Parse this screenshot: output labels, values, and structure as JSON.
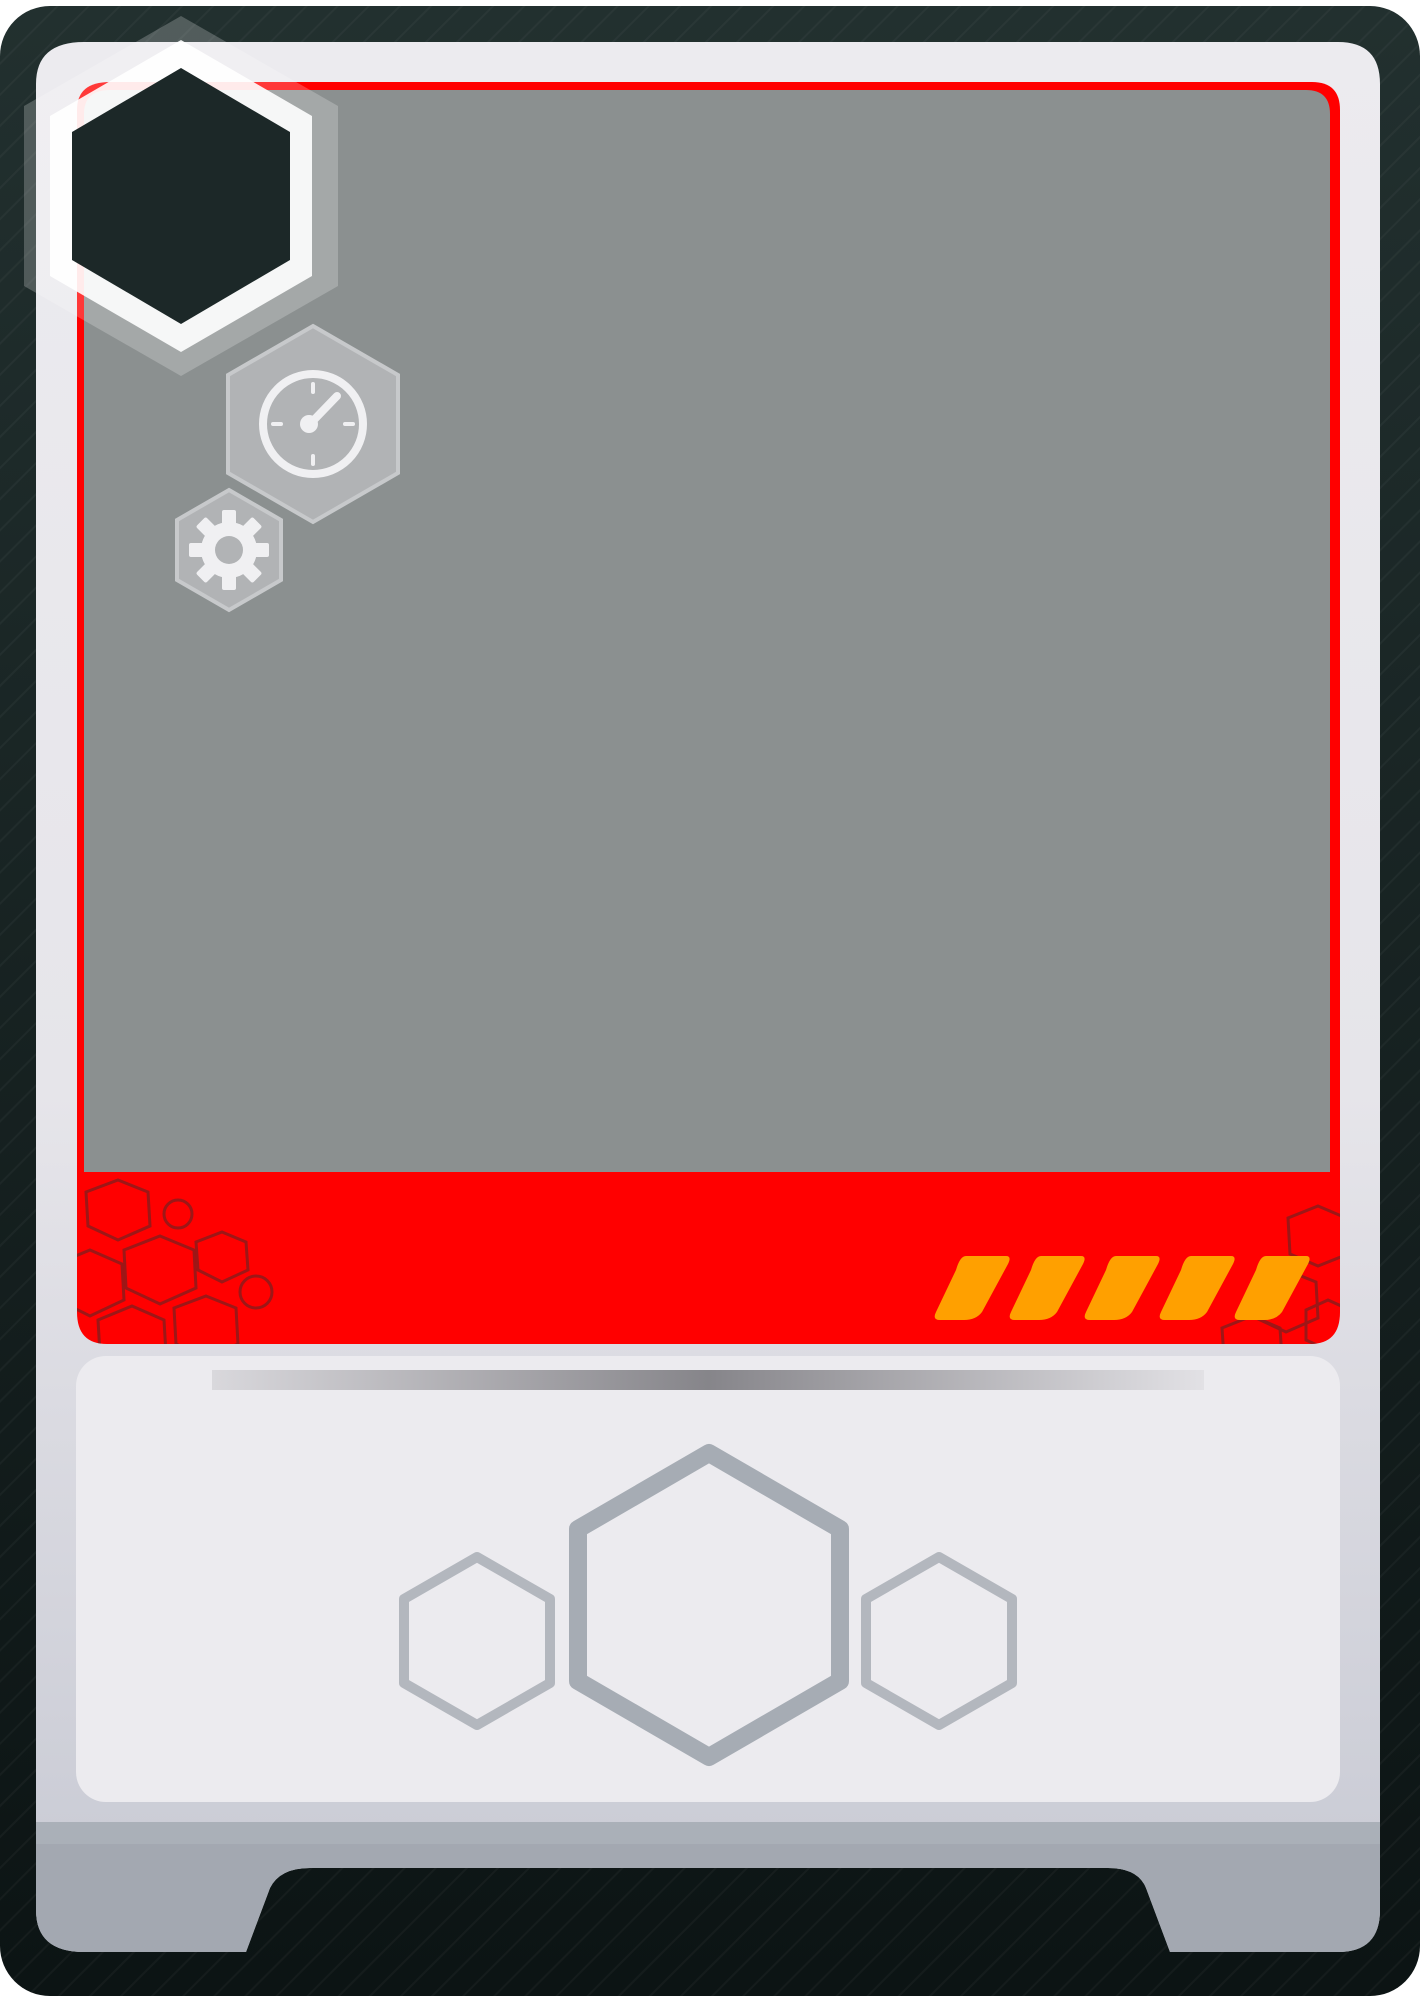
{
  "card": {
    "colors": {
      "frame_top": "#22302f",
      "frame_bottom": "#0c1414",
      "panel_light": "#ecebef",
      "panel_bottom": "#a3a8b1",
      "art_placeholder": "#8b9090",
      "accent_red": "#ff0000",
      "energy_orange": "#ffa000",
      "hex_outline": "#a7adb5",
      "icon_badge": "#b1b3b5"
    },
    "icons": {
      "cost_gem": "hexagon-gem",
      "timer": "stopwatch-icon",
      "gear": "gear-icon"
    },
    "energy": {
      "filled": 5,
      "total": 5
    },
    "ability_slots": [
      "small-hex-slot",
      "large-hex-slot",
      "small-hex-slot"
    ]
  }
}
